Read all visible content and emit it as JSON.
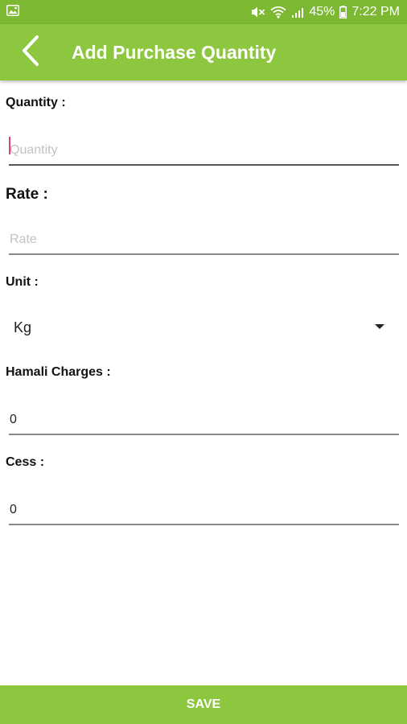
{
  "status_bar": {
    "battery": "45%",
    "time": "7:22 PM",
    "icons": [
      "image-icon",
      "mute-icon",
      "wifi-icon",
      "signal-icon",
      "battery-icon"
    ]
  },
  "app_bar": {
    "title": "Add Purchase Quantity",
    "back_icon": "chevron-left-icon"
  },
  "form": {
    "quantity": {
      "label": "Quantity :",
      "value": "",
      "placeholder": "Quantity"
    },
    "rate": {
      "label": "Rate :",
      "value": "",
      "placeholder": "Rate"
    },
    "unit": {
      "label": "Unit :",
      "selected": "Kg"
    },
    "hamali_charges": {
      "label": "Hamali Charges :",
      "value": "0"
    },
    "cess": {
      "label": "Cess :",
      "value": "0"
    }
  },
  "save_label": "SAVE",
  "colors": {
    "status_bar": "#7cb831",
    "app_bar": "#8dc63f",
    "cursor": "#e0407a"
  }
}
